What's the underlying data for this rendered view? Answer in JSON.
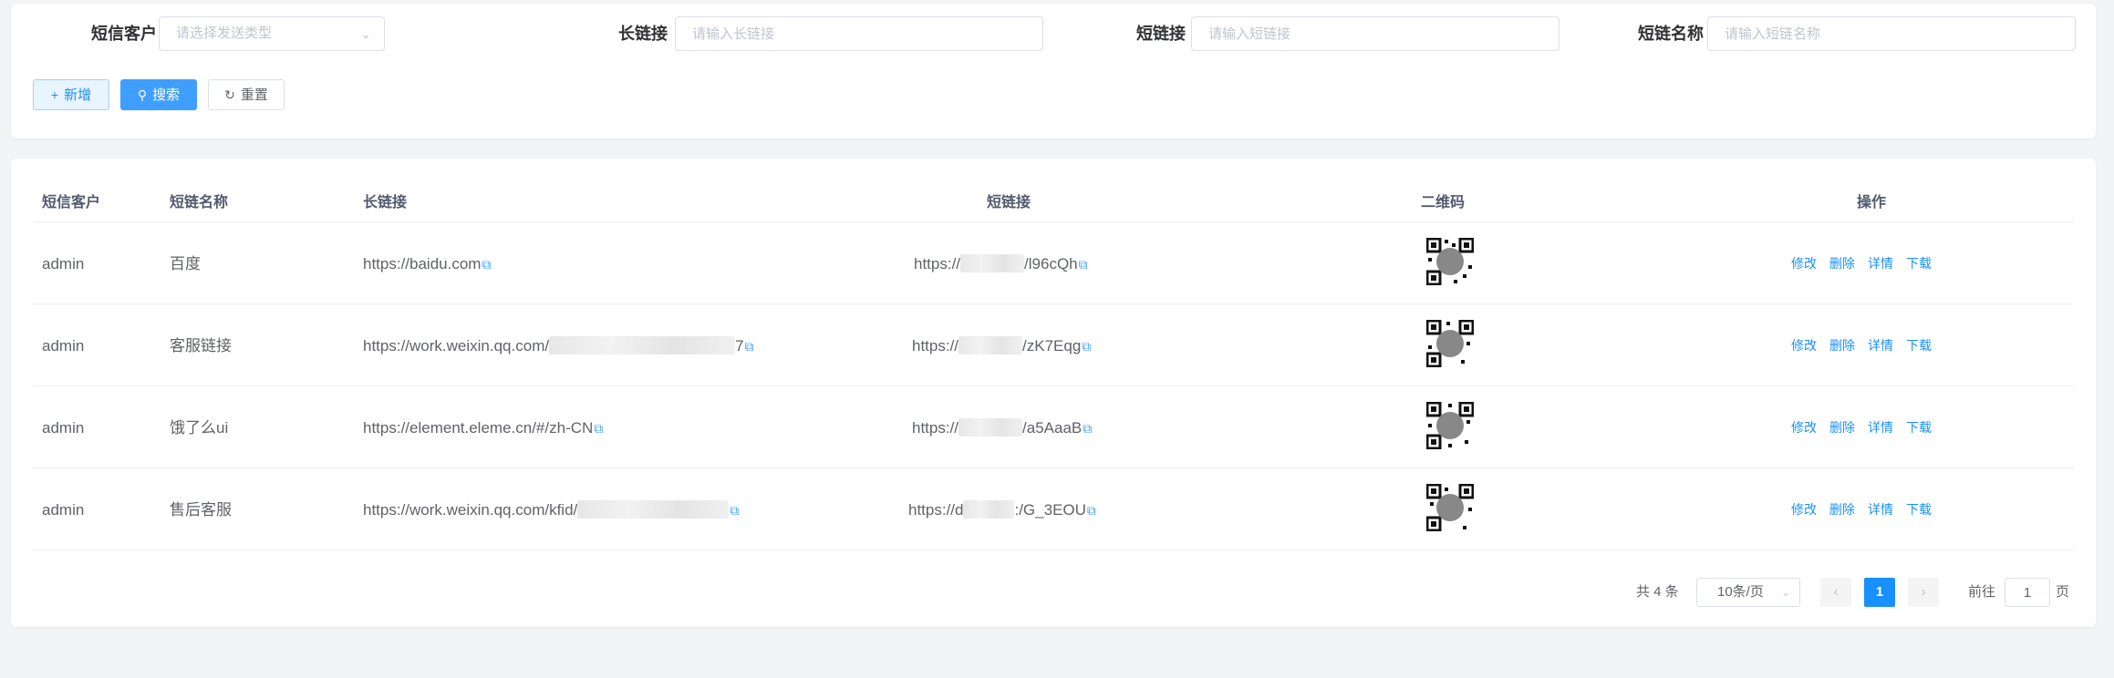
{
  "search": {
    "customer_label": "短信客户",
    "customer_placeholder": "请选择发送类型",
    "long_label": "长链接",
    "long_placeholder": "请输入长链接",
    "short_label": "短链接",
    "short_placeholder": "请输入短链接",
    "name_label": "短链名称",
    "name_placeholder": "请输入短链名称",
    "add_label": "新增",
    "search_label": "搜索",
    "reset_label": "重置"
  },
  "table": {
    "columns": [
      "短信客户",
      "短链名称",
      "长链接",
      "短链接",
      "二维码",
      "操作"
    ],
    "rows": [
      {
        "customer": "admin",
        "name": "百度",
        "long_url": "https://baidu.com",
        "long_suffix": "",
        "short_prefix": "https://",
        "short_suffix": "/l96cQh"
      },
      {
        "customer": "admin",
        "name": "客服链接",
        "long_url": "https://work.weixin.qq.com/",
        "long_suffix": "7",
        "short_prefix": "https://",
        "short_suffix": "/zK7Eqg"
      },
      {
        "customer": "admin",
        "name": "饿了么ui",
        "long_url": "https://element.eleme.cn/#/zh-CN",
        "long_suffix": "",
        "short_prefix": "https://",
        "short_suffix": "/a5AaaB"
      },
      {
        "customer": "admin",
        "name": "售后客服",
        "long_url": "https://work.weixin.qq.com/kfid/",
        "long_suffix": "",
        "short_prefix": "https://d",
        "short_suffix": ":/G_3EOU"
      }
    ],
    "actions": [
      "修改",
      "删除",
      "详情",
      "下载"
    ]
  },
  "pagination": {
    "total": "共 4 条",
    "page_size": "10条/页",
    "current_page": "1",
    "goto_prefix": "前往",
    "goto_value": "1",
    "goto_suffix": "页"
  },
  "colors": {
    "primary": "#1890ff",
    "background": "#f2f4f6"
  }
}
